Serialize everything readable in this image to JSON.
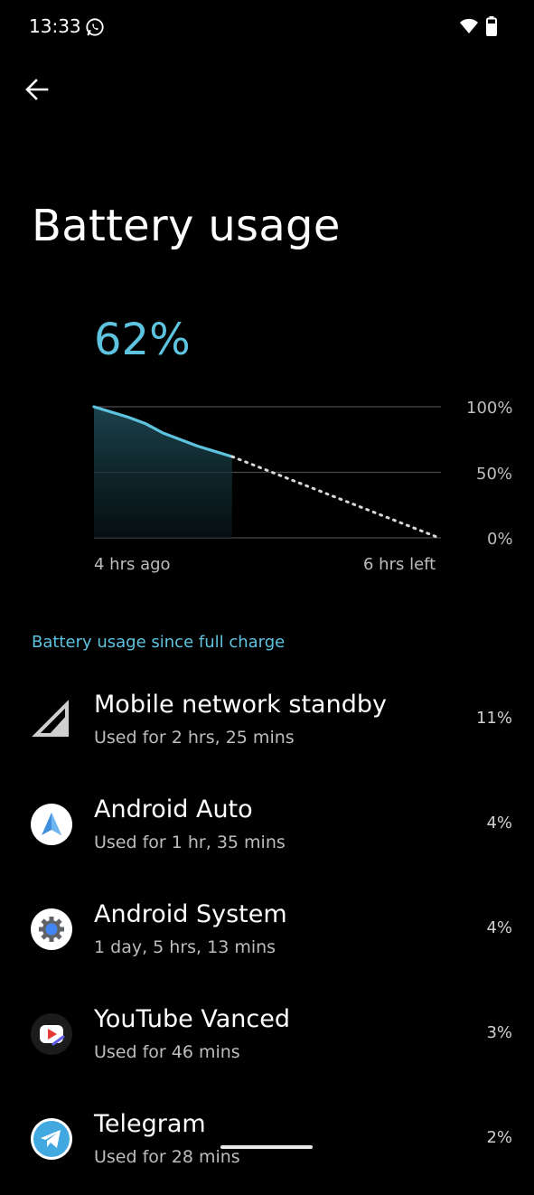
{
  "status_bar": {
    "time": "13:33",
    "icons": [
      "whatsapp-icon",
      "wifi-icon",
      "battery-icon"
    ]
  },
  "header": {
    "back_icon": "arrow-left-icon",
    "title": "Battery usage"
  },
  "battery": {
    "level_text": "62%"
  },
  "chart_data": {
    "type": "area",
    "series": [
      {
        "x": [
          -4,
          -3.5,
          -3,
          -2.5,
          -2,
          -1.5,
          -1,
          -0.5,
          0
        ],
        "y": [
          100,
          96,
          92,
          87,
          80,
          75,
          70,
          66,
          62
        ]
      }
    ],
    "projection": {
      "x": [
        0,
        6
      ],
      "y": [
        62,
        0
      ],
      "style": "dotted"
    },
    "y_ticks": [
      "100%",
      "50%",
      "0%"
    ],
    "x_labels": [
      "4 hrs ago",
      "6 hrs left"
    ],
    "ylim": [
      0,
      100
    ],
    "grid": true,
    "accent_color": "#5ec3df"
  },
  "section": {
    "title": "Battery usage since full charge"
  },
  "usage_items": [
    {
      "icon": "mobile-signal-icon",
      "name": "Mobile network standby",
      "detail": "Used for 2 hrs, 25 mins",
      "percent": "11%"
    },
    {
      "icon": "android-auto-icon",
      "name": "Android Auto",
      "detail": "Used for 1 hr, 35 mins",
      "percent": "4%"
    },
    {
      "icon": "android-system-icon",
      "name": "Android System",
      "detail": "1 day, 5 hrs, 13 mins",
      "percent": "4%"
    },
    {
      "icon": "youtube-vanced-icon",
      "name": "YouTube Vanced",
      "detail": "Used for 46 mins",
      "percent": "3%"
    },
    {
      "icon": "telegram-icon",
      "name": "Telegram",
      "detail": "Used for 28 mins",
      "percent": "2%"
    }
  ]
}
